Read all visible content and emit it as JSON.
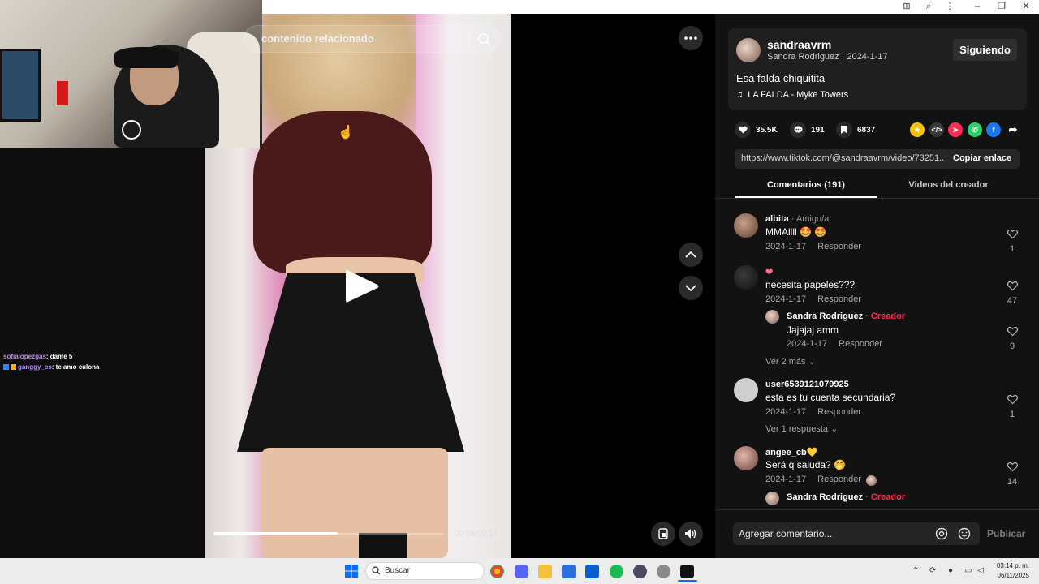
{
  "browser": {
    "toolbar_icons": [
      "translate-icon",
      "zoom-icon",
      "kebab-menu-icon"
    ],
    "window_controls": [
      "minimize-icon",
      "restore-icon",
      "close-icon"
    ]
  },
  "video": {
    "search_placeholder": "contenido relacionado",
    "timecode": "00:08/00:15",
    "progress": 0.54
  },
  "stream_chat": [
    {
      "user": "sofialopezgas",
      "message": ": dame 5"
    },
    {
      "user": "ganggy_cs",
      "message": ": te amo culona"
    }
  ],
  "profile": {
    "username": "sandraavrm",
    "display_name": "Sandra Rodriguez",
    "date": "2024-1-17",
    "sub_separator": " · ",
    "follow_label": "Siguiendo",
    "caption": "Esa falda chiquitita",
    "music": "LA FALDA - Myke Towers"
  },
  "stats": {
    "likes": "35.5K",
    "comments": "191",
    "saves": "6837"
  },
  "share": {
    "url": "https://www.tiktok.com/@sandraavrm/video/73251...",
    "copy_label": "Copiar enlace"
  },
  "tabs": {
    "comments": "Comentarios (191)",
    "videos": "Videos del creador"
  },
  "comments": [
    {
      "user": "albita",
      "tag": " · Amigo/a",
      "text": "MMAllll 🤩 🤩",
      "date": "2024-1-17",
      "reply": "Responder",
      "likes": "1"
    },
    {
      "user": "",
      "tag": "",
      "text": "necesita papeles???",
      "date": "2024-1-17",
      "reply": "Responder",
      "likes": "47"
    },
    {
      "user": "Sandra Rodriguez",
      "tag": " · Creador",
      "text": "Jajajaj amm",
      "date": "2024-1-17",
      "reply": "Responder",
      "likes": "9"
    },
    {
      "user": "user6539121079925",
      "tag": "",
      "text": "esta es tu cuenta secundaria?",
      "date": "2024-1-17",
      "reply": "Responder",
      "likes": "1"
    },
    {
      "user": "angee_cb💛",
      "tag": "",
      "text": "Será q saluda? 🤭",
      "date": "2024-1-17",
      "reply": "Responder",
      "likes": "14"
    },
    {
      "user": "Sandra Rodriguez",
      "tag": " · Creador",
      "text": "",
      "date": "",
      "reply": "",
      "likes": ""
    }
  ],
  "more_replies": [
    "Ver 2 más",
    "Ver 1 respuesta"
  ],
  "comment_input": {
    "placeholder": "Agregar comentario...",
    "publish": "Publicar"
  },
  "taskbar": {
    "search": "Buscar",
    "time": "03:14 p. m.",
    "date": "06/11/2025"
  },
  "colors": {
    "accent": "#fe2c55",
    "panel": "#121212",
    "card": "#1f1f1f"
  }
}
